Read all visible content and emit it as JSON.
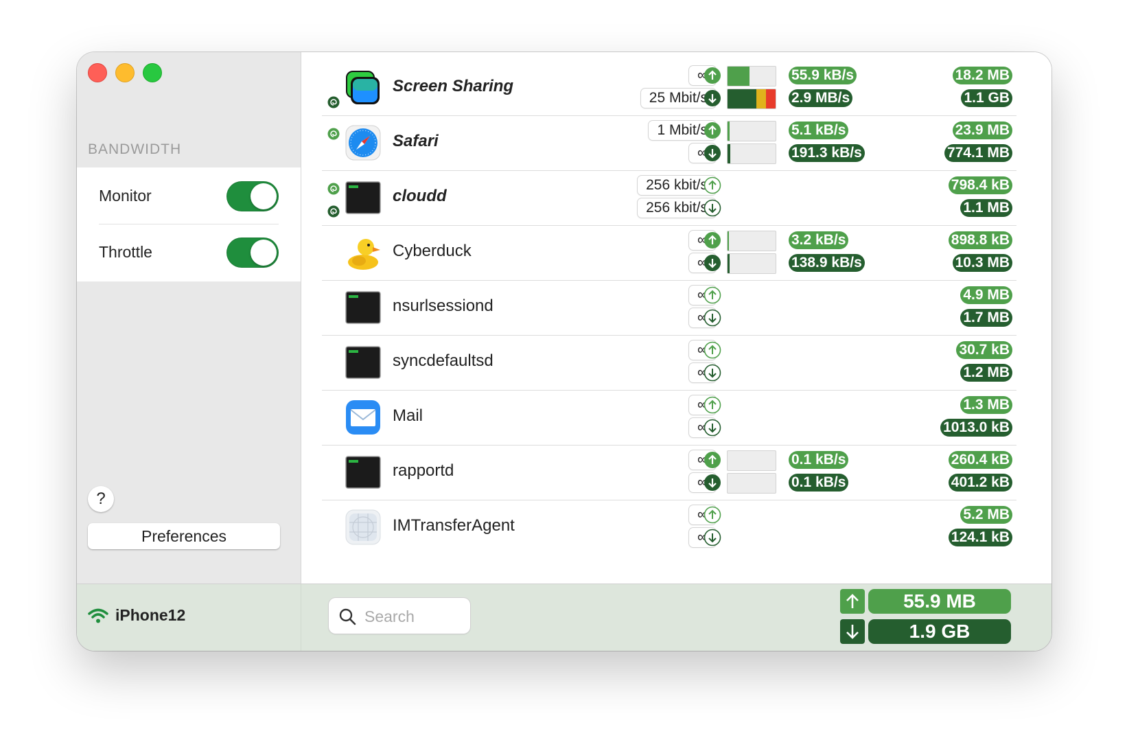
{
  "sidebar": {
    "section_title": "BANDWIDTH",
    "settings": [
      {
        "label": "Monitor",
        "enabled": true
      },
      {
        "label": "Throttle",
        "enabled": true
      }
    ],
    "help_label": "?",
    "preferences_label": "Preferences",
    "device": "iPhone12"
  },
  "colors": {
    "accent_up": "#4fa04b",
    "accent_down": "#255e2f",
    "meter_yellow": "#e0b21c",
    "meter_red": "#e83b2b"
  },
  "apps": [
    {
      "name": "Screen Sharing",
      "icon": "screen-sharing-icon",
      "bold": true,
      "limit_up": "∞",
      "limit_down": "25 Mbit/s",
      "rate_up": "55.9 kB/s",
      "rate_down": "2.9 MB/s",
      "total_up": "18.2 MB",
      "total_down": "1.1 GB"
    },
    {
      "name": "Safari",
      "icon": "safari-icon",
      "bold": true,
      "limit_up": "1 Mbit/s",
      "limit_down": "∞",
      "rate_up": "5.1 kB/s",
      "rate_down": "191.3 kB/s",
      "total_up": "23.9 MB",
      "total_down": "774.1 MB"
    },
    {
      "name": "cloudd",
      "icon": "terminal-exec-icon",
      "bold": true,
      "limit_up": "256 kbit/s",
      "limit_down": "256 kbit/s",
      "total_up": "798.4 kB",
      "total_down": "1.1 MB"
    },
    {
      "name": "Cyberduck",
      "icon": "cyberduck-icon",
      "bold": false,
      "limit_up": "∞",
      "limit_down": "∞",
      "rate_up": "3.2 kB/s",
      "rate_down": "138.9 kB/s",
      "total_up": "898.8 kB",
      "total_down": "10.3 MB"
    },
    {
      "name": "nsurlsessiond",
      "icon": "terminal-exec-icon",
      "bold": false,
      "limit_up": "∞",
      "limit_down": "∞",
      "total_up": "4.9 MB",
      "total_down": "1.7 MB"
    },
    {
      "name": "syncdefaultsd",
      "icon": "terminal-exec-icon",
      "bold": false,
      "limit_up": "∞",
      "limit_down": "∞",
      "total_up": "30.7 kB",
      "total_down": "1.2 MB"
    },
    {
      "name": "Mail",
      "icon": "mail-icon",
      "bold": false,
      "limit_up": "∞",
      "limit_down": "∞",
      "total_up": "1.3 MB",
      "total_down": "1013.0 kB"
    },
    {
      "name": "rapportd",
      "icon": "terminal-exec-icon",
      "bold": false,
      "limit_up": "∞",
      "limit_down": "∞",
      "rate_up": "0.1 kB/s",
      "rate_down": "0.1 kB/s",
      "total_up": "260.4 kB",
      "total_down": "401.2 kB"
    },
    {
      "name": "IMTransferAgent",
      "icon": "generic-app-icon",
      "bold": false,
      "limit_up": "∞",
      "limit_down": "∞",
      "total_up": "5.2 MB",
      "total_down": "124.1 kB"
    }
  ],
  "footer": {
    "search_placeholder": "Search",
    "total_up": "55.9 MB",
    "total_down": "1.9 GB"
  }
}
